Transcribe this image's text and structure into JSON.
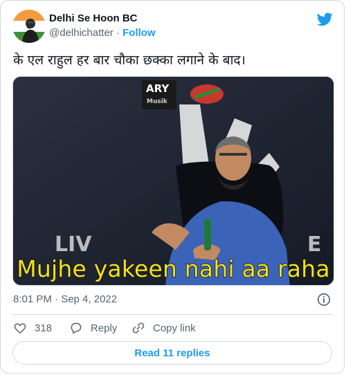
{
  "user": {
    "display_name": "Delhi Se Hoon BC",
    "handle": "@delhichatter",
    "separator": "·",
    "follow_label": "Follow"
  },
  "tweet": {
    "text": "के एल राहुल हर बार चौका छक्का लगाने के बाद।",
    "timestamp": "8:01 PM · Sep 4, 2022"
  },
  "media": {
    "caption": "Mujhe yakeen nahi aa raha",
    "logo_text": "ARY",
    "logo_subtext": "Musik",
    "bg_text_left": "LIV",
    "bg_text_right": "E"
  },
  "actions": {
    "like_count": "318",
    "reply_label": "Reply",
    "copy_link_label": "Copy link"
  },
  "footer": {
    "read_replies_label": "Read 11 replies"
  },
  "colors": {
    "accent": "#1d9bf0",
    "text": "#0f1419",
    "muted": "#536471",
    "border": "#cfd9de",
    "caption": "#f4e21b"
  },
  "icons": [
    "twitter-bird-icon",
    "info-icon",
    "heart-icon",
    "reply-icon",
    "link-icon"
  ]
}
